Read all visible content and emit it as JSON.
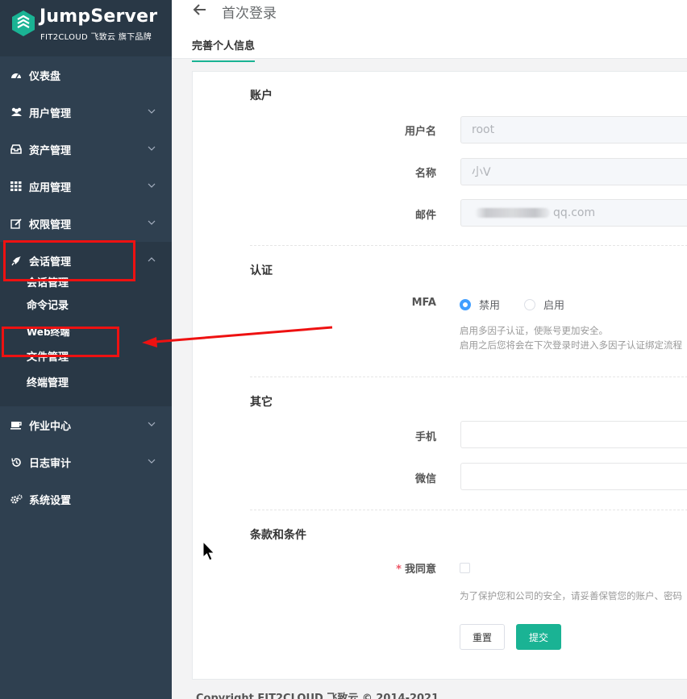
{
  "brand": {
    "name": "JumpServer",
    "tagline": "FIT2CLOUD 飞致云 旗下品牌",
    "color": "#1ab394"
  },
  "sidebar": {
    "items": [
      {
        "label": "仪表盘",
        "icon": "dashboard-icon"
      },
      {
        "label": "用户管理",
        "icon": "users-icon"
      },
      {
        "label": "资产管理",
        "icon": "inbox-icon"
      },
      {
        "label": "应用管理",
        "icon": "grid-icon"
      },
      {
        "label": "权限管理",
        "icon": "edit-icon"
      },
      {
        "label": "会话管理",
        "icon": "rocket-icon"
      },
      {
        "label": "作业中心",
        "icon": "coffee-icon"
      },
      {
        "label": "日志审计",
        "icon": "history-icon"
      },
      {
        "label": "系统设置",
        "icon": "gears-icon"
      }
    ],
    "sessions_sub": [
      "会话管理",
      "命令记录",
      "Web终端",
      "文件管理",
      "终端管理"
    ]
  },
  "header": {
    "title": "首次登录",
    "tab": "完善个人信息"
  },
  "form": {
    "account_section": "账户",
    "username_label": "用户名",
    "username_value": "root",
    "name_label": "名称",
    "name_value": "小V",
    "email_label": "邮件",
    "email_value": "qq.com",
    "auth_section": "认证",
    "mfa_label": "MFA",
    "mfa_options": [
      "禁用",
      "启用"
    ],
    "mfa_selected": "禁用",
    "mfa_help_1": "启用多因子认证，使账号更加安全。",
    "mfa_help_2": "启用之后您将会在下次登录时进入多因子认证绑定流程",
    "other_section": "其它",
    "phone_label": "手机",
    "wechat_label": "微信",
    "terms_section": "条款和条件",
    "agree_label": "我同意",
    "agree_required_mark": "*",
    "agree_help": "为了保护您和公司的安全，请妥善保管您的账户、密码",
    "reset_button": "重置",
    "submit_button": "提交"
  },
  "footer": {
    "text": "Copyright FIT2CLOUD 飞致云 © 2014-2021"
  },
  "colors": {
    "sidebar_bg": "#2f4050",
    "annotation_red": "#ee1111",
    "radio_blue": "#409eff"
  }
}
